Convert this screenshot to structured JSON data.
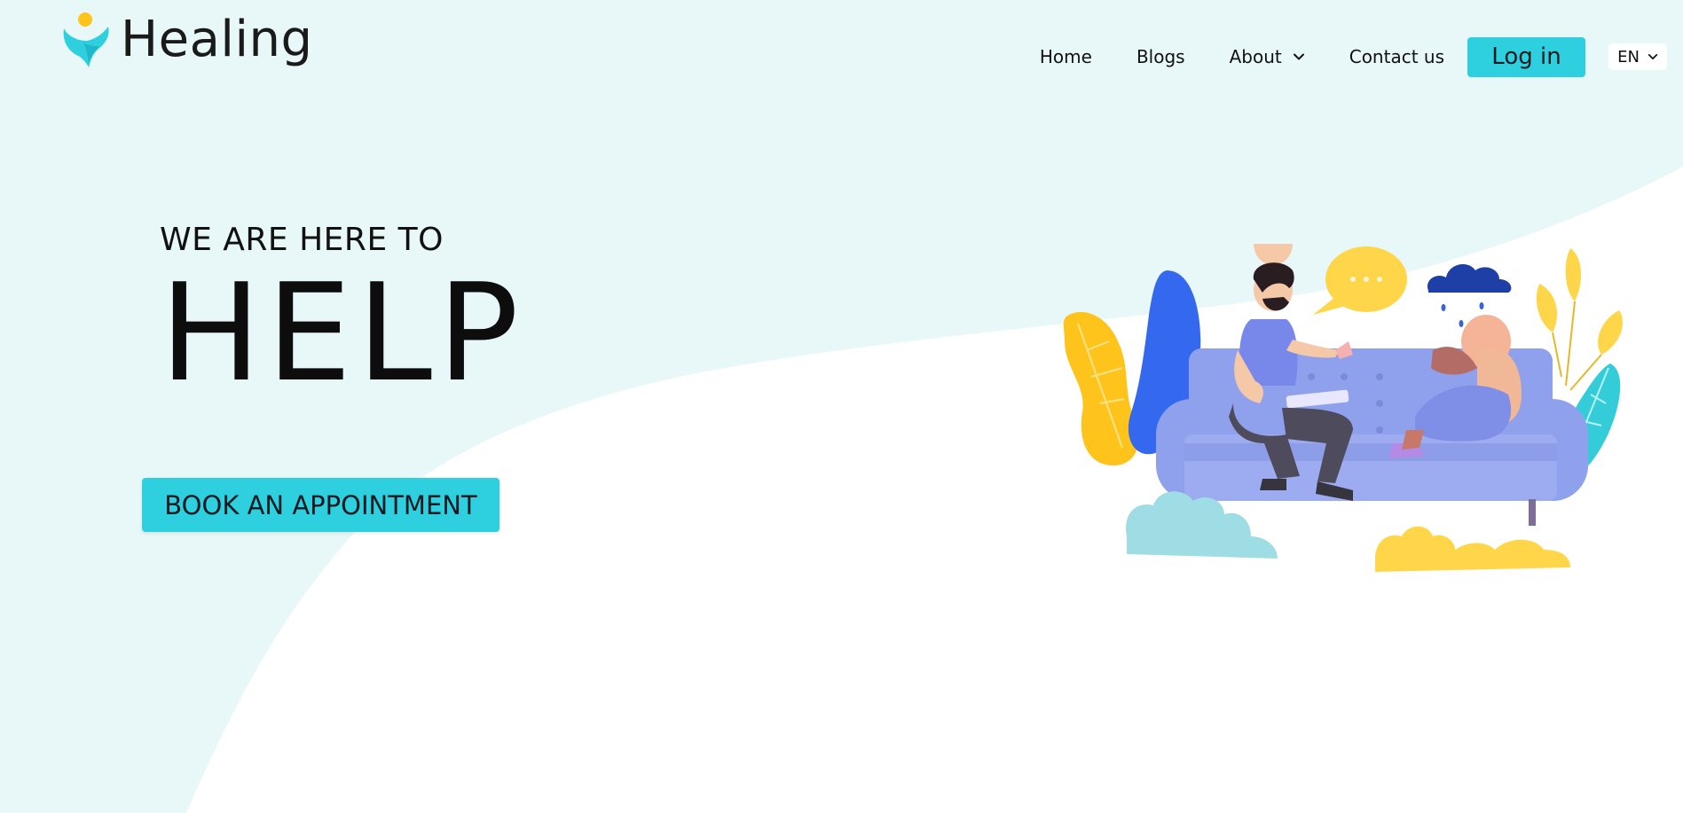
{
  "brand": {
    "name": "Healing",
    "logo_icon": "healing-logo-icon",
    "primary_color": "#2ed0e0",
    "accent_color": "#ffc41c",
    "background_tint": "#e8f7f8"
  },
  "nav": {
    "items": [
      {
        "label": "Home"
      },
      {
        "label": "Blogs"
      },
      {
        "label": "About",
        "has_dropdown": true
      },
      {
        "label": "Contact us"
      }
    ],
    "login_label": "Log in",
    "language": {
      "selected": "EN"
    }
  },
  "hero": {
    "subtitle": "WE ARE HERE TO",
    "title": "HELP",
    "cta_label": "BOOK AN APPOINTMENT",
    "illustration": "therapy-session-illustration"
  }
}
